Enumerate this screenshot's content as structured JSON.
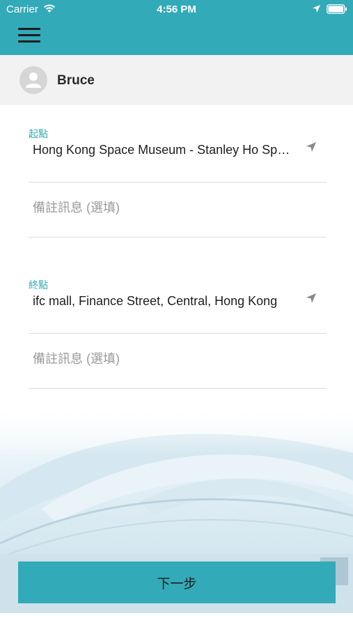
{
  "status_bar": {
    "carrier": "Carrier",
    "time": "4:56 PM"
  },
  "header": {
    "icon": "menu-icon"
  },
  "user": {
    "name": "Bruce",
    "avatar_icon": "avatar-placeholder-icon"
  },
  "origin": {
    "label": "起點",
    "location": "Hong Kong Space Museum - Stanley Ho Space Theatre, Salisbury Road",
    "remarks_placeholder": "備註訊息 (選填)",
    "locate_icon": "location-arrow-icon"
  },
  "destination": {
    "label": "終點",
    "location": "ifc mall, Finance Street, Central, Hong Kong",
    "remarks_placeholder": "備註訊息 (選填)",
    "locate_icon": "location-arrow-icon"
  },
  "next_button": {
    "label": "下一步"
  },
  "colors": {
    "accent": "#32aab8",
    "user_row_bg": "#f2f2f2"
  }
}
